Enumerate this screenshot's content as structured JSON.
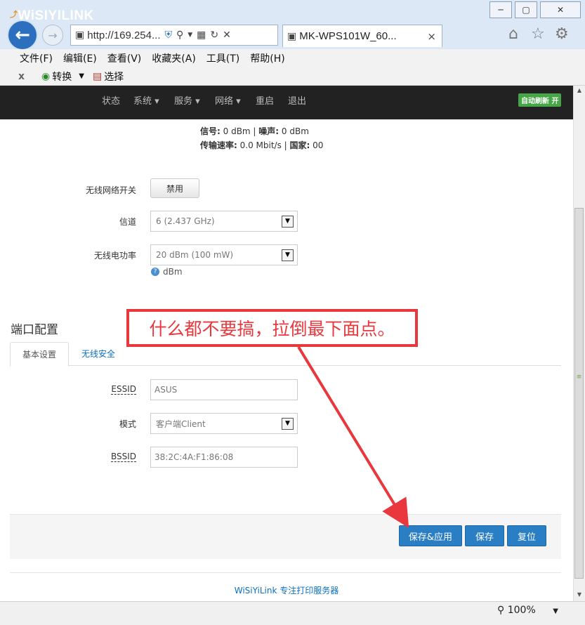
{
  "browser": {
    "address": "http://169.254...",
    "tab_title": "MK-WPS101W_60...",
    "tab_close": "×",
    "window_buttons": {
      "minimize": "─",
      "maximize": "▢",
      "close": "✕"
    },
    "menu": [
      "文件(F)",
      "编辑(E)",
      "查看(V)",
      "收藏夹(A)",
      "工具(T)",
      "帮助(H)"
    ],
    "command_bar": {
      "close_x": "x",
      "convert": "转换",
      "select": "选择"
    },
    "zoom": "100%"
  },
  "header": {
    "logo": "WiSIYILINK",
    "nav": [
      "状态",
      "系统 ▾",
      "服务 ▾",
      "网络 ▾",
      "重启",
      "退出"
    ],
    "auto_refresh": "自动刷新 开"
  },
  "status_info": {
    "signal_label": "信号:",
    "signal_value": " 0 dBm | ",
    "noise_label": "噪声:",
    "noise_value": " 0 dBm",
    "rate_label": "传输速率:",
    "rate_value": " 0.0 Mbit/s | ",
    "country_label": "国家:",
    "country_value": " 00"
  },
  "wireless": {
    "switch_label": "无线网络开关",
    "switch_button": "禁用",
    "channel_label": "信道",
    "channel_value": "6 (2.437 GHz)",
    "power_label": "无线电功率",
    "power_value": "20 dBm (100 mW)",
    "power_unit": "dBm"
  },
  "interface": {
    "section_title": "端口配置",
    "tabs": [
      "基本设置",
      "无线安全"
    ],
    "essid_label": "ESSID",
    "essid_value": "ASUS",
    "mode_label": "模式",
    "mode_value": "客户端Client",
    "bssid_label": "BSSID",
    "bssid_value": "38:2C:4A:F1:86:08"
  },
  "actions": {
    "save_apply": "保存&应用",
    "save": "保存",
    "reset": "复位"
  },
  "footer": "WiSiYiLink 专注打印服务器",
  "annotation": {
    "text": "什么都不要搞，拉倒最下面点。",
    "color": "#e8383d"
  }
}
